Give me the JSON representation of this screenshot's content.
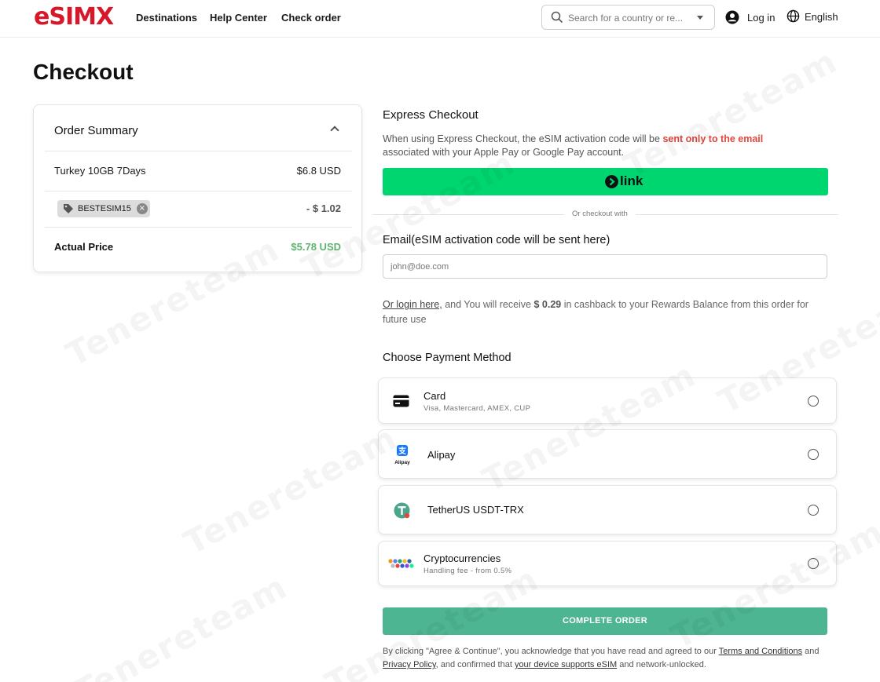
{
  "header": {
    "logo": "eSIMX",
    "nav": [
      "Destinations",
      "Help Center",
      "Check order"
    ],
    "search_placeholder": "Search for a country or re...",
    "login": "Log in",
    "language": "English"
  },
  "page_title": "Checkout",
  "order_summary": {
    "title": "Order Summary",
    "item_name": "Turkey 10GB 7Days",
    "item_price": "$6.8 USD",
    "coupon_code": "BESTESIM15",
    "discount": "- $ 1.02",
    "actual_label": "Actual Price",
    "actual_value": "$5.78 USD"
  },
  "express": {
    "title": "Express Checkout",
    "text_before": "When using Express Checkout, the eSIM activation code will be ",
    "text_warn": "sent only to the email",
    "text_after": " associated with your Apple Pay or Google Pay account.",
    "link_button": "link",
    "or_text": "Or checkout with"
  },
  "email": {
    "label": "Email(eSIM activation code will be sent here)",
    "placeholder": "john@doe.com"
  },
  "cashback": {
    "login_link": "Or login here,",
    "text_before": " and You will receive ",
    "amount": "$ 0.29",
    "text_after": " in cashback to your Rewards Balance from this order for future use"
  },
  "payment": {
    "title": "Choose Payment Method",
    "methods": [
      {
        "name": "Card",
        "sub": "Visa, Mastercard, AMEX, CUP",
        "icon": "credit-card-icon"
      },
      {
        "name": "Alipay",
        "sub": "",
        "icon": "alipay-icon"
      },
      {
        "name": "TetherUS USDT-TRX",
        "sub": "",
        "icon": "tether-icon"
      },
      {
        "name": "Cryptocurrencies",
        "sub": "Handling fee - from 0.5%",
        "icon": "crypto-icon"
      }
    ]
  },
  "complete_button": "COMPLETE ORDER",
  "terms": {
    "t1": "By clicking \"Agree & Continue\", you acknowledge that you have read and agreed to our ",
    "link1": "Terms and Conditions",
    "t2": " and ",
    "link2": "Privacy Policy",
    "t3": ", and confirmed that ",
    "link3": "your device supports eSIM",
    "t4": " and network-unlocked."
  },
  "watermark": "Tenereteam",
  "colors": {
    "brand": "#d7182a",
    "link_green": "#00d66f",
    "complete_green": "#4db592",
    "price_green": "#5fb36e",
    "warn_red": "#e0473e"
  }
}
